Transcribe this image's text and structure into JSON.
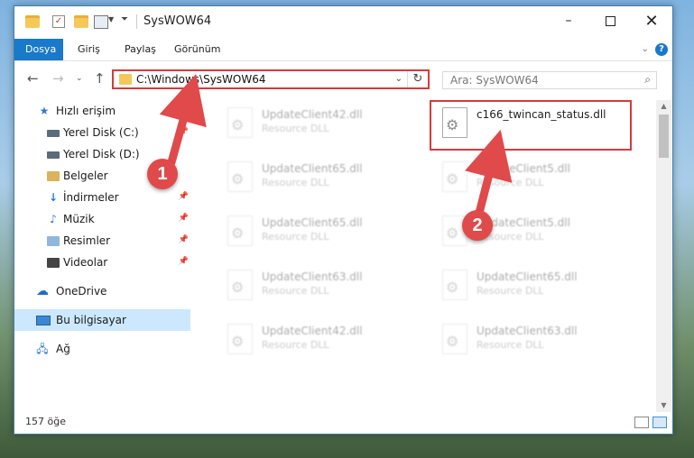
{
  "window": {
    "title": "SysWOW64",
    "min_label": "–",
    "close_label": "✕"
  },
  "ribbon": {
    "tabs": [
      "Dosya",
      "Giriş",
      "Paylaş",
      "Görünüm"
    ],
    "expand_label": "⌄",
    "help_label": "?"
  },
  "nav": {
    "address": "C:\\Windows\\SysWOW64",
    "search_placeholder": "Ara: SysWOW64",
    "refresh_label": "↻"
  },
  "sidebar": {
    "items": [
      {
        "label": "Hızlı erişim",
        "icon": "star-icon"
      },
      {
        "label": "Yerel Disk (C:)",
        "icon": "disk-icon"
      },
      {
        "label": "Yerel Disk (D:)",
        "icon": "disk-icon"
      },
      {
        "label": "Belgeler",
        "icon": "document-folder-icon"
      },
      {
        "label": "İndirmeler",
        "icon": "download-icon"
      },
      {
        "label": "Müzik",
        "icon": "music-icon"
      },
      {
        "label": "Resimler",
        "icon": "pictures-icon"
      },
      {
        "label": "Videolar",
        "icon": "video-icon"
      },
      {
        "label": "OneDrive",
        "icon": "cloud-icon"
      },
      {
        "label": "Bu bilgisayar",
        "icon": "computer-icon"
      },
      {
        "label": "Ağ",
        "icon": "network-icon"
      }
    ]
  },
  "files": [
    {
      "name": "UpdateClient42.dll",
      "desc": "Resource DLL"
    },
    {
      "name": "c166_twincan_status.dll",
      "desc": ""
    },
    {
      "name": "UpdateClient65.dll",
      "desc": "Resource DLL"
    },
    {
      "name": "UpdateClient5.dll",
      "desc": "Resource DLL"
    },
    {
      "name": "UpdateClient65.dll",
      "desc": "Resource DLL"
    },
    {
      "name": "UpdateClient5.dll",
      "desc": "Resource DLL"
    },
    {
      "name": "UpdateClient63.dll",
      "desc": "Resource DLL"
    },
    {
      "name": "UpdateClient65.dll",
      "desc": "Resource DLL"
    },
    {
      "name": "UpdateClient42.dll",
      "desc": "Resource DLL"
    },
    {
      "name": "UpdateClient63.dll",
      "desc": "Resource DLL"
    }
  ],
  "status": {
    "item_count": "157 öğe"
  },
  "annotations": {
    "badge1": "1",
    "badge2": "2",
    "color": "#d83a3a"
  }
}
